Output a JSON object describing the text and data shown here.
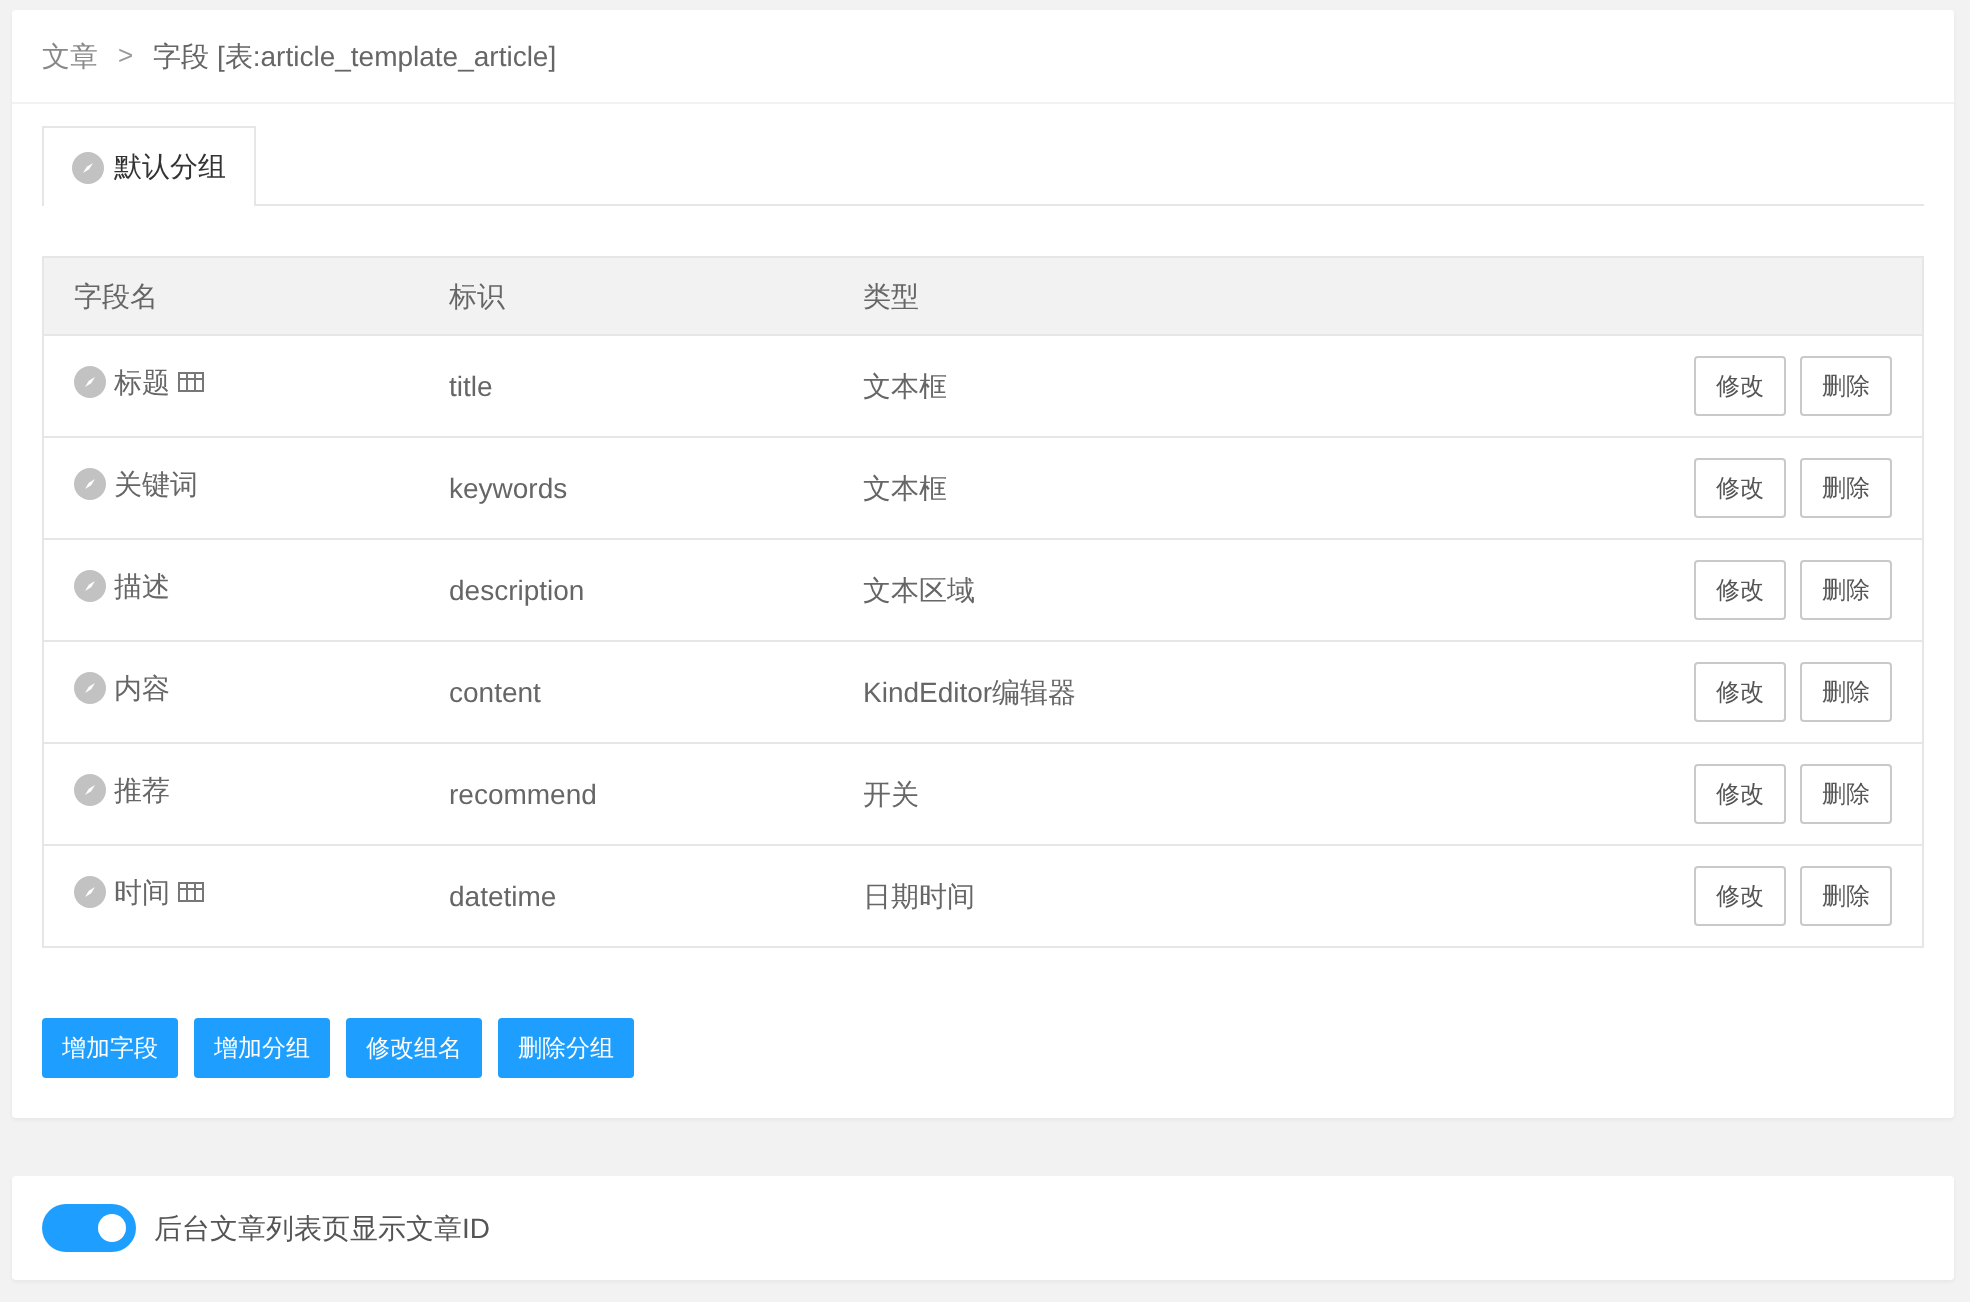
{
  "breadcrumb": [
    {
      "label": "文章"
    },
    {
      "label": "字段 [表:article_template_article]"
    }
  ],
  "breadcrumb_separator": ">",
  "tabs": [
    {
      "label": "默认分组",
      "selected": true
    }
  ],
  "table": {
    "columns": [
      "字段名",
      "标识",
      "类型"
    ],
    "rows": [
      {
        "name": "标题",
        "grid_icon": true,
        "key": "title",
        "type": "文本框",
        "actions": [
          "修改",
          "删除"
        ]
      },
      {
        "name": "关键词",
        "grid_icon": false,
        "key": "keywords",
        "type": "文本框",
        "actions": [
          "修改",
          "删除"
        ]
      },
      {
        "name": "描述",
        "grid_icon": false,
        "key": "description",
        "type": "文本区域",
        "actions": [
          "修改",
          "删除"
        ]
      },
      {
        "name": "内容",
        "grid_icon": false,
        "key": "content",
        "type": "KindEditor编辑器",
        "actions": [
          "修改",
          "删除"
        ]
      },
      {
        "name": "推荐",
        "grid_icon": false,
        "key": "recommend",
        "type": "开关",
        "actions": [
          "修改",
          "删除"
        ]
      },
      {
        "name": "时间",
        "grid_icon": true,
        "key": "datetime",
        "type": "日期时间",
        "actions": [
          "修改",
          "删除"
        ]
      }
    ]
  },
  "buttons": [
    "增加字段",
    "增加分组",
    "修改组名",
    "删除分组"
  ],
  "setting": {
    "label": "后台文章列表页显示文章ID",
    "on": true
  }
}
